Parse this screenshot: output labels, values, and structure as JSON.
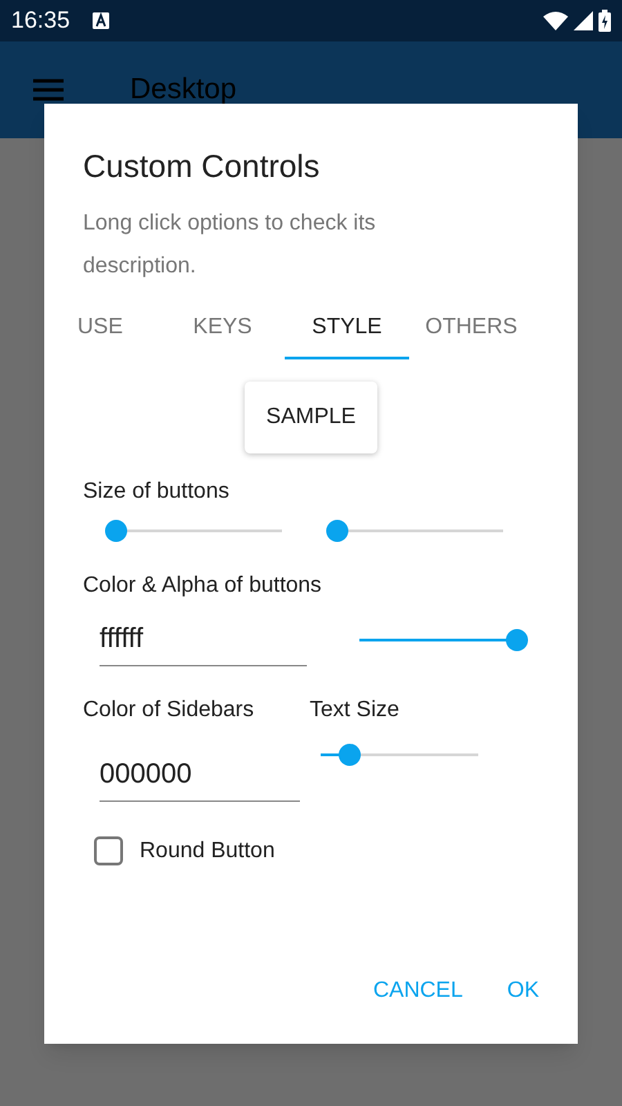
{
  "status_bar": {
    "time": "16:35"
  },
  "app_bar": {
    "title": "Desktop"
  },
  "dialog": {
    "title": "Custom Controls",
    "description": "Long click options to check its description.",
    "tabs": [
      {
        "label": "USE",
        "selected": false
      },
      {
        "label": "KEYS",
        "selected": false
      },
      {
        "label": "STYLE",
        "selected": true
      },
      {
        "label": "OTHERS",
        "selected": false
      }
    ],
    "sample_button": "SAMPLE",
    "size_label": "Size of buttons",
    "size_sliders": [
      {
        "level": 0
      },
      {
        "level": 0
      }
    ],
    "color_label": "Color & Alpha of buttons",
    "color_field": {
      "value": "ffffff"
    },
    "alpha_slider": {
      "level": 1
    },
    "sidebar_color_label": "Color of Sidebars",
    "text_size_label": "Text Size",
    "sidebar_color_field": {
      "value": "000000"
    },
    "text_size_slider": {
      "level": 0.2
    },
    "round_button": {
      "label": "Round Button",
      "checked": false
    },
    "buttons": [
      "CANCEL",
      "OK"
    ]
  }
}
